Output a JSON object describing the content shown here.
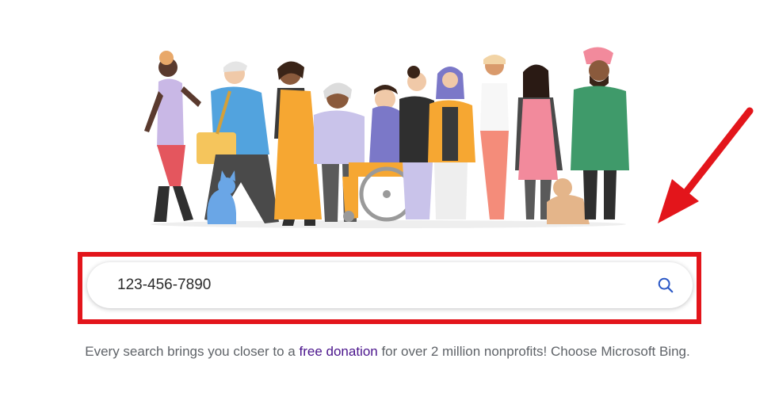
{
  "search": {
    "value": "123-456-7890"
  },
  "tagline": {
    "prefix": "Every search brings you closer to a ",
    "link": "free donation",
    "suffix": " for over 2 million nonprofits! Choose Microsoft Bing."
  },
  "icons": {
    "search": "search-icon",
    "annotation": "red-arrow-icon"
  },
  "colors": {
    "highlight": "#e3151b",
    "search_icon": "#2b58c6",
    "link": "#4a148c",
    "tagline_text": "#5f6368"
  }
}
